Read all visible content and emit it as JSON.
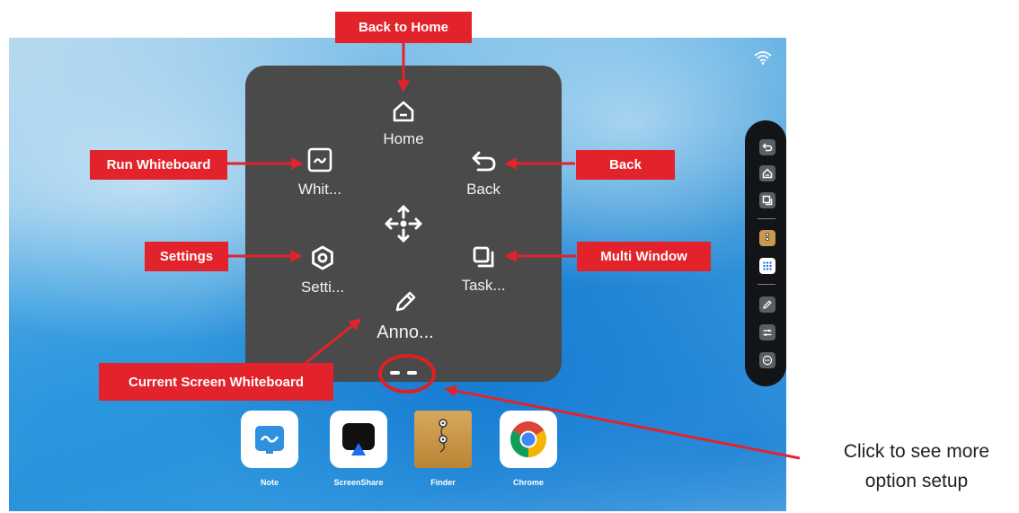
{
  "panel": {
    "home_label": "Home",
    "whiteboard_label": "Whit...",
    "back_label": "Back",
    "settings_label": "Setti...",
    "task_label": "Task...",
    "annotation_label": "Anno..."
  },
  "dock": {
    "apps": [
      {
        "name": "Note"
      },
      {
        "name": "ScreenShare"
      },
      {
        "name": "Finder"
      },
      {
        "name": "Chrome"
      }
    ]
  },
  "callouts": {
    "back_to_home": "Back to Home",
    "run_whiteboard": "Run Whiteboard",
    "back": "Back",
    "settings": "Settings",
    "multi_window": "Multi Window",
    "current_screen_whiteboard": "Current Screen  Whiteboard"
  },
  "note": {
    "line1": "Click to see more",
    "line2": "option setup"
  },
  "colors": {
    "callout": "#e3232b",
    "panel": "#4a4a4a",
    "toolbar": "#121417"
  }
}
